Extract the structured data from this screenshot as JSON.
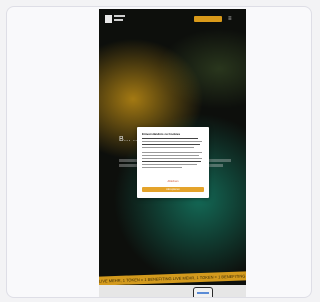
{
  "site": {
    "cta_label": "",
    "menu_icon": "hamburger-icon",
    "hero_heading": "B… …nd"
  },
  "ticker": {
    "text": "LIVE MEHR, 1 TOKEN = 1 BENEFITING  LIVE MEHR, 1 TOKEN = 1 BENEFITING"
  },
  "consent": {
    "title": "Einverständnis zu Cookies",
    "decline_label": "Ablehnen",
    "accept_label": "Akzeptieren"
  },
  "colors": {
    "accent": "#d99a1a",
    "background": "#0d0f0c",
    "glow_gold": "#be8c14",
    "glow_teal": "#146e5a"
  }
}
